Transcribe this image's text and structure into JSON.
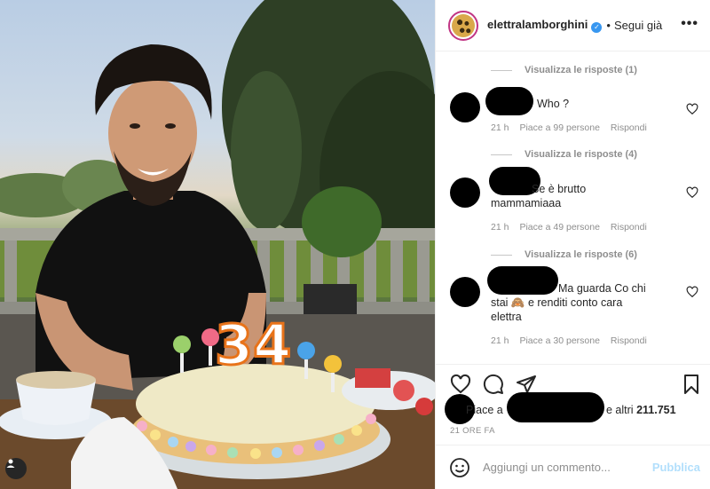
{
  "post": {
    "username": "elettralamborghini",
    "follow_status": "Segui già",
    "dot": "•",
    "more": "•••",
    "photo_alt": "man smiling behind a birthday cake",
    "cake_number": "34"
  },
  "comments": [
    {
      "view_replies": "Visualizza le risposte (1)",
      "text": "Who ?",
      "time": "21 h",
      "likes": "Piace a 99 persone",
      "reply": "Rispondi"
    },
    {
      "view_replies": "Visualizza le risposte (4)",
      "text_line1": "Se è brutto",
      "text_line2": "mammamiaaa",
      "time": "21 h",
      "likes": "Piace a 49 persone",
      "reply": "Rispondi"
    },
    {
      "view_replies": "Visualizza le risposte (6)",
      "text_line1": "Ma guarda Co chi",
      "text_line2": "stai 🙈 e renditi conto cara",
      "text_line3": "elettra",
      "time": "21 h",
      "likes": "Piace a 30 persone",
      "reply": "Rispondi"
    }
  ],
  "likes_bar": {
    "prefix": "Piace a",
    "suffix": "e altri",
    "count": "211.751"
  },
  "timestamp": "21 ORE FA",
  "add_comment": {
    "placeholder": "Aggiungi un commento...",
    "post_label": "Pubblica"
  },
  "colors": {
    "accent_link": "#b2dffc",
    "verified": "#3897f0",
    "muted": "#8e8e8e"
  },
  "icons": [
    "heart-icon",
    "comment-icon",
    "share-icon",
    "bookmark-icon",
    "emoji-icon",
    "user-tag-icon",
    "verified-icon",
    "more-icon"
  ]
}
